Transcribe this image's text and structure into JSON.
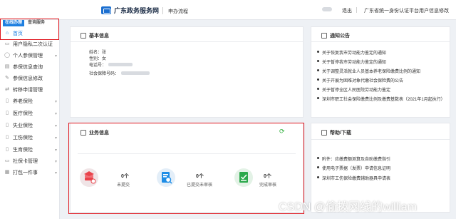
{
  "header": {
    "site_name": "广东政务服务网",
    "section": "申办流程",
    "logout": "退出",
    "identity_link": "广东省统一身份认证平台用户信息修改"
  },
  "sidebar": {
    "tabs": [
      "在线办理",
      "查询服务"
    ],
    "items": [
      {
        "label": "首页",
        "icon": "home-icon",
        "active": true
      },
      {
        "label": "用户隐私二次认证",
        "icon": "lock-icon"
      },
      {
        "label": "个人参保管理",
        "icon": "user-icon"
      },
      {
        "label": "参保信息查询",
        "icon": "search-doc-icon"
      },
      {
        "label": "参保信息修改",
        "icon": "edit-icon"
      },
      {
        "label": "转移申请管理",
        "icon": "transfer-icon"
      },
      {
        "label": "养老保险",
        "icon": "doc-icon"
      },
      {
        "label": "医疗保险",
        "icon": "doc-icon"
      },
      {
        "label": "失业保险",
        "icon": "doc-icon"
      },
      {
        "label": "工伤保险",
        "icon": "doc-icon"
      },
      {
        "label": "生育保险",
        "icon": "doc-icon"
      },
      {
        "label": "社保卡管理",
        "icon": "card-icon"
      },
      {
        "label": "打包一件事",
        "icon": "package-icon"
      }
    ]
  },
  "basic_info": {
    "title": "基本信息",
    "fields": [
      {
        "label": "姓名：",
        "value": "张"
      },
      {
        "label": "性别：",
        "value": "女"
      },
      {
        "label": "电话号：",
        "value": ""
      },
      {
        "label": "社会保障号码：",
        "value": ""
      }
    ]
  },
  "notices": {
    "title": "通知公告",
    "items": [
      "关于恢复我市劳动能力鉴定的通知",
      "关于暂停我市劳动能力鉴定的通知",
      "关于调整灵活就业人员基本养老保险缴费比例的通知",
      "关于开展为困难对象代缴社会保险费的公告",
      "关于暂停全区人民医院劳动能力鉴定",
      "深圳市职工社会保险缴费比例及缴费基数表（2021年1月起执行）"
    ]
  },
  "business": {
    "title": "业务信息",
    "stats": [
      {
        "count": "0个",
        "label": "未提交",
        "icon": "stack-icon",
        "color": "#e9434b"
      },
      {
        "count": "0个",
        "label": "已提交未审核",
        "icon": "doc-search-icon",
        "color": "#1e8de6"
      },
      {
        "count": "0个",
        "label": "完成审核",
        "icon": "checklist-icon",
        "color": "#2aa84a"
      }
    ]
  },
  "help": {
    "title": "帮助/下载",
    "items": [
      "附件：应缴费额测算及自助缴费指引",
      "使用电子票据（发票）申请信息证明",
      "深圳市工伤保险缴费辅助器具申请表"
    ]
  },
  "watermark": "CSDN @偷拨网线的william"
}
